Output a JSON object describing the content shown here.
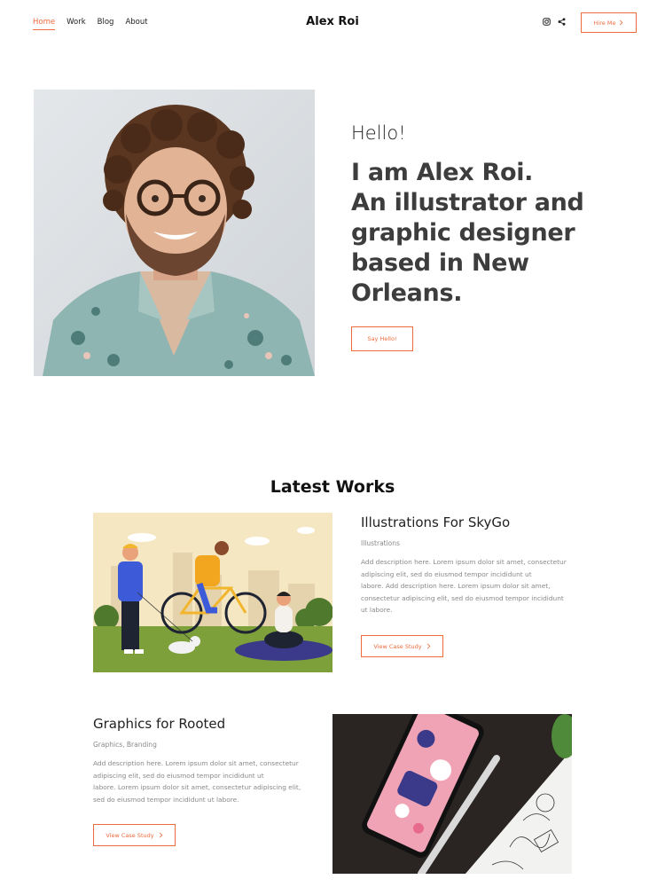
{
  "nav": {
    "links": [
      {
        "label": "Home",
        "active": true
      },
      {
        "label": "Work",
        "active": false
      },
      {
        "label": "Blog",
        "active": false
      },
      {
        "label": "About",
        "active": false
      }
    ],
    "brand": "Alex Roi",
    "icons": [
      "instagram-icon",
      "share-icon"
    ],
    "hire_label": "Hire Me"
  },
  "hero": {
    "greeting": "Hello!",
    "headline_lines": [
      "I am Alex Roi.",
      "An illustrator and",
      "graphic designer",
      "based in New",
      "Orleans."
    ],
    "cta_label": "Say Hello!"
  },
  "works": {
    "title": "Latest Works",
    "items": [
      {
        "title": "Illustrations For SkyGo",
        "category": "Illustrations",
        "description_lines": [
          "Add description here. Lorem ipsum dolor sit amet, consectetur",
          "adipiscing elit, sed do eiusmod tempor incididunt ut",
          "labore. Add description here. Lorem ipsum dolor sit amet,",
          "consectetur adipiscing elit, sed do eiusmod tempor incididunt",
          "ut labore."
        ],
        "button_label": "View Case Study"
      },
      {
        "title": "Graphics for Rooted",
        "category": "Graphics, Branding",
        "description_lines": [
          "Add description here. Lorem ipsum dolor sit amet, consectetur",
          "adipiscing elit, sed do eiusmod tempor incididunt ut",
          "labore. Lorem ipsum dolor sit amet, consectetur adipiscing elit,",
          "sed do eiusmod tempor incididunt ut labore."
        ],
        "button_label": "View Case Study"
      }
    ]
  },
  "colors": {
    "accent": "#ec6b3c",
    "heading": "#3d3d3d",
    "muted": "#888888"
  }
}
